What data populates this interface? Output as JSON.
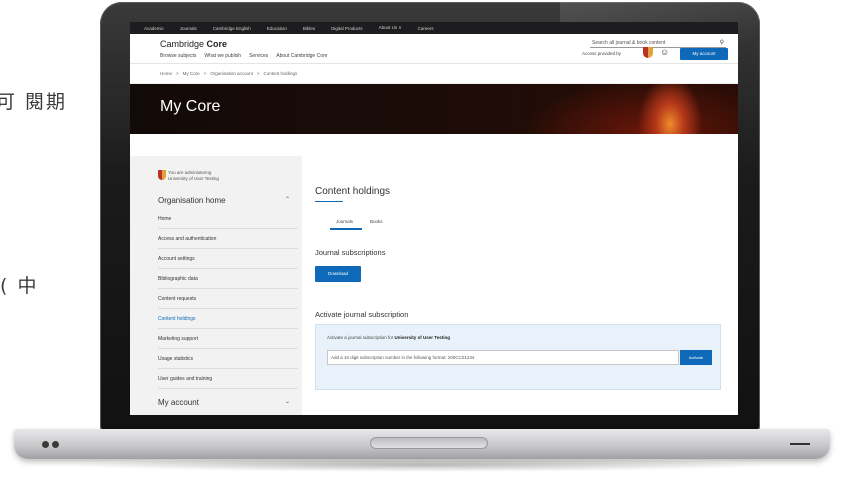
{
  "background_text": {
    "line1": "可 閱期",
    "line2": "( 中"
  },
  "topnav": {
    "items": [
      "Academic",
      "Journals",
      "Cambridge English",
      "Education",
      "Bibles",
      "Digital Products",
      "About Us ∨",
      "Careers"
    ]
  },
  "header": {
    "logo_light": "Cambridge ",
    "logo_bold": "Core",
    "search_placeholder": "Search all journal & book content",
    "subnav": [
      "Browse subjects",
      "What we publish",
      "Services",
      "About Cambridge Core"
    ],
    "access_text": "Access provided by",
    "mycore_label": "My account"
  },
  "breadcrumb": [
    "Home",
    ">",
    "My Core",
    ">",
    "Organisation account",
    ">",
    "Content holdings"
  ],
  "hero": {
    "title": "My Core"
  },
  "sidebar": {
    "admin_line1": "You are administering",
    "admin_line2": "University of User Testing",
    "section_title": "Organisation home",
    "items": [
      "Home",
      "Access and authentication",
      "Account settings",
      "Bibliographic data",
      "Content requests",
      "Content holdings",
      "Marketing support",
      "Usage statistics",
      "User guides and training"
    ],
    "active_item": "Content holdings",
    "footer_title": "My account"
  },
  "main": {
    "title": "Content holdings",
    "tabs": [
      "Journals",
      "Books"
    ],
    "journal_subscriptions_title": "Journal subscriptions",
    "download_label": "Download",
    "activate_title": "Activate journal subscription",
    "activate_text_prefix": "Activate a journal subscription for ",
    "activate_text_org": "University of User Testing",
    "input_placeholder": "Add a 10 digit subscription number in the following format: 200CC01234",
    "activate_button": "Activate"
  },
  "colors": {
    "accent": "#0e6ab8",
    "topnav_bg": "#1d1d1f",
    "sidebar_bg": "#f2f2f2",
    "activate_box_bg": "#e9f2fa"
  }
}
